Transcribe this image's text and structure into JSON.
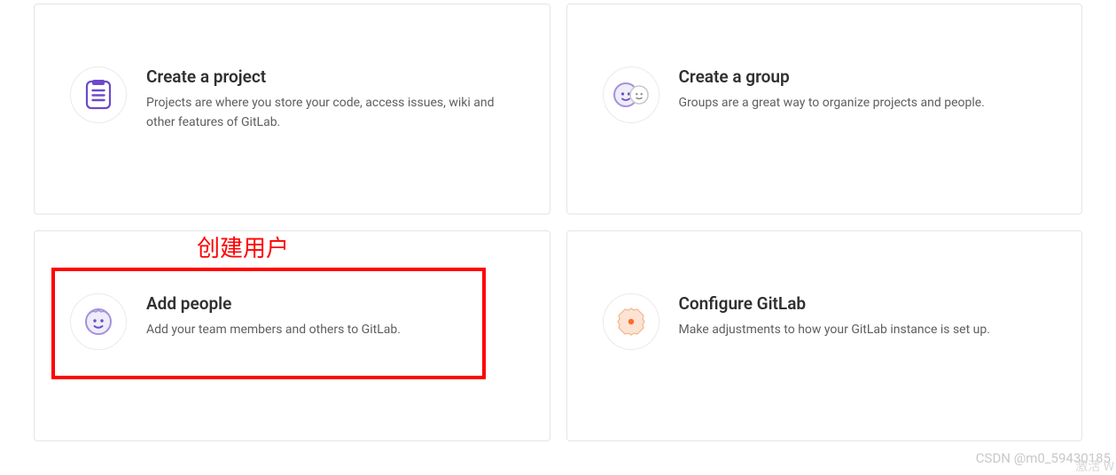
{
  "cards": {
    "create_project": {
      "title": "Create a project",
      "desc": "Projects are where you store your code, access issues, wiki and other features of GitLab."
    },
    "create_group": {
      "title": "Create a group",
      "desc": "Groups are a great way to organize projects and people."
    },
    "add_people": {
      "title": "Add people",
      "desc": "Add your team members and others to GitLab."
    },
    "configure": {
      "title": "Configure GitLab",
      "desc": "Make adjustments to how your GitLab instance is set up."
    }
  },
  "annotation": {
    "label": "创建用户"
  },
  "watermarks": {
    "csdn": "CSDN @m0_59430185",
    "activate": "激活 W"
  }
}
